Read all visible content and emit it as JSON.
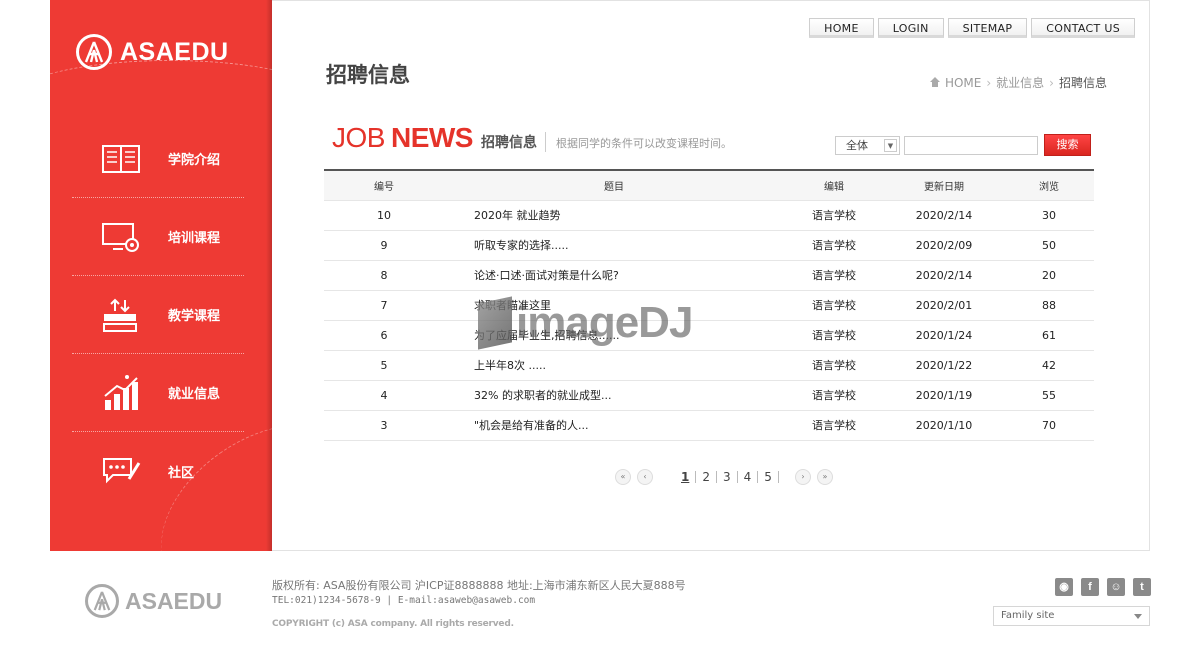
{
  "brand": {
    "name": "ASAEDU"
  },
  "sidebar": {
    "items": [
      {
        "label": "学院介绍",
        "icon": "book-icon"
      },
      {
        "label": "培训课程",
        "icon": "monitor-icon"
      },
      {
        "label": "教学课程",
        "icon": "stack-icon"
      },
      {
        "label": "就业信息",
        "icon": "growth-chart-icon"
      },
      {
        "label": "社区",
        "icon": "chat-bubble-icon"
      }
    ]
  },
  "topnav": {
    "home": "HOME",
    "login": "LOGIN",
    "sitemap": "SITEMAP",
    "contact": "CONTACT US"
  },
  "page": {
    "title": "招聘信息"
  },
  "breadcrumb": {
    "home": "HOME",
    "section": "就业信息",
    "current": "招聘信息"
  },
  "board": {
    "job": "JOB",
    "news": "NEWS",
    "title_zh": "招聘信息",
    "description": "根据同学的条件可以改变课程时间。"
  },
  "search": {
    "select_value": "全体",
    "input_value": "",
    "button_label": "搜索"
  },
  "table": {
    "headers": {
      "no": "编号",
      "title": "题目",
      "editor": "编辑",
      "date": "更新日期",
      "views": "浏览"
    },
    "rows": [
      {
        "no": "10",
        "title": "2020年 就业趋势",
        "editor": "语言学校",
        "date": "2020/2/14",
        "views": "30"
      },
      {
        "no": "9",
        "title": "听取专家的选择.....",
        "editor": "语言学校",
        "date": "2020/2/09",
        "views": "50"
      },
      {
        "no": "8",
        "title": "论述·口述·面试对策是什么呢?",
        "editor": "语言学校",
        "date": "2020/2/14",
        "views": "20"
      },
      {
        "no": "7",
        "title": "求职者瞄准这里",
        "editor": "语言学校",
        "date": "2020/2/01",
        "views": "88"
      },
      {
        "no": "6",
        "title": "为了应届毕业生,招聘信息......",
        "editor": "语言学校",
        "date": "2020/1/24",
        "views": "61"
      },
      {
        "no": "5",
        "title": "上半年8次 .....",
        "editor": "语言学校",
        "date": "2020/1/22",
        "views": "42"
      },
      {
        "no": "4",
        "title": "32% 的求职者的就业成型...",
        "editor": "语言学校",
        "date": "2020/1/19",
        "views": "55"
      },
      {
        "no": "3",
        "title": "\"机会是给有准备的人...",
        "editor": "语言学校",
        "date": "2020/1/10",
        "views": "70"
      }
    ]
  },
  "pager": {
    "first": "«",
    "prev": "‹",
    "pages": [
      "1",
      "2",
      "3",
      "4",
      "5"
    ],
    "next": "›",
    "last": "»"
  },
  "watermark": {
    "text": "imageDJ"
  },
  "footer": {
    "brand": "ASAEDU",
    "line1": "版权所有: ASA股份有限公司 沪ICP证8888888 地址:上海市浦东新区人民大夏888号",
    "line2": "TEL:021)1234-5678-9 | E-mail:asaweb@asaweb.com",
    "copyright": "COPYRIGHT (c) ASA company. All rights reserved.",
    "family_site": "Family site",
    "social": [
      "weibo-icon",
      "facebook-icon",
      "chat-icon",
      "twitter-icon"
    ]
  },
  "colors": {
    "brand_red": "#ee3a34",
    "news_red": "#e5332a"
  }
}
